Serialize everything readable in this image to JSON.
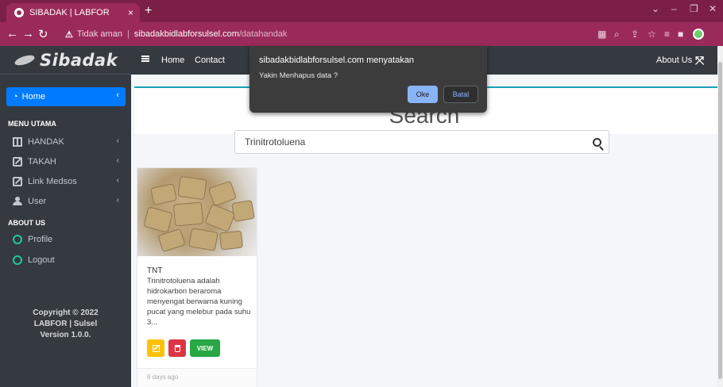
{
  "browser": {
    "tab_title": "SIBADAK | LABFOR",
    "tab_close": "×",
    "new_tab": "+",
    "not_secure": "Tidak aman",
    "url_domain": "sibadakbidlabforsulsel.com",
    "url_path": "/datahandak",
    "profile_letter": "s"
  },
  "brand": {
    "name": "Sibadak"
  },
  "topnav": {
    "home": "Home",
    "contact": "Contact",
    "about": "About Us"
  },
  "sidebar": {
    "home_label": "Home",
    "section_main": "MENU UTAMA",
    "items": [
      {
        "label": "HANDAK",
        "icon": "table-icon"
      },
      {
        "label": "TAKAH",
        "icon": "edit-icon"
      },
      {
        "label": "Link Medsos",
        "icon": "edit-icon"
      },
      {
        "label": "User",
        "icon": "users-icon"
      }
    ],
    "section_about": "ABOUT US",
    "about_items": [
      {
        "label": "Profile",
        "icon": "circle-icon"
      },
      {
        "label": "Logout",
        "icon": "circle-icon"
      }
    ],
    "copyright_line1": "Copyright © 2022",
    "copyright_line2": "LABFOR | Sulsel",
    "copyright_line3": "Version 1.0.0."
  },
  "main": {
    "search_title": "Search",
    "search_value": "Trinitrotoluena"
  },
  "card": {
    "name": "TNT",
    "description": "Trinitrotoluena adalah hidrokarbon beraroma menyengat berwarna kuning pucat yang melebur pada suhu 3...",
    "view_label": "VIEW",
    "footer": "6 days ago"
  },
  "dialog": {
    "title": "sibadakbidlabforsulsel.com menyatakan",
    "message": "Yakin Menhapus data ?",
    "ok_label": "Oke",
    "cancel_label": "Batal"
  },
  "colors": {
    "browser_frame": "#9a2a5a",
    "sidebar": "#343a40",
    "primary": "#007bff",
    "dialog_button": "#8ab4f8"
  }
}
